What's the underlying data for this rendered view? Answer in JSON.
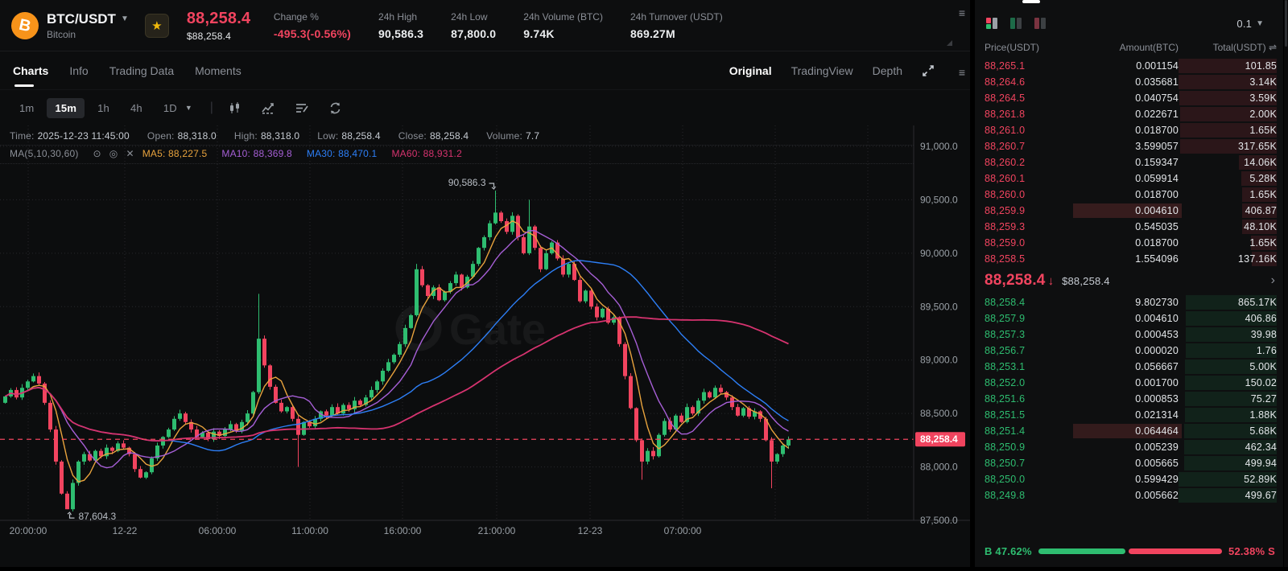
{
  "header": {
    "pair": "BTC/USDT",
    "coin_name": "Bitcoin",
    "logo_letter": "B",
    "last_price": "88,258.4",
    "last_price_usd": "$88,258.4",
    "stats": [
      {
        "label": "Change %",
        "value": "-495.3(-0.56%)",
        "red": true
      },
      {
        "label": "24h High",
        "value": "90,586.3",
        "red": false
      },
      {
        "label": "24h Low",
        "value": "87,800.0",
        "red": false
      },
      {
        "label": "24h Volume (BTC)",
        "value": "9.74K",
        "red": false
      },
      {
        "label": "24h Turnover (USDT)",
        "value": "869.27M",
        "red": false
      }
    ]
  },
  "tabs": {
    "left": [
      "Charts",
      "Info",
      "Trading Data",
      "Moments"
    ],
    "left_active": 0,
    "right": [
      "Original",
      "TradingView",
      "Depth"
    ],
    "right_active": 0
  },
  "toolbar": {
    "timeframes": [
      "1m",
      "15m",
      "1h",
      "4h",
      "1D"
    ],
    "active": "15m"
  },
  "info_bar": [
    {
      "label": "Time:",
      "value": "2025-12-23 11:45:00"
    },
    {
      "label": "Open:",
      "value": "88,318.0"
    },
    {
      "label": "High:",
      "value": "88,318.0"
    },
    {
      "label": "Low:",
      "value": "88,258.4"
    },
    {
      "label": "Close:",
      "value": "88,258.4"
    },
    {
      "label": "Volume:",
      "value": "7.7"
    }
  ],
  "ma_bar": {
    "label": "MA(5,10,30,60)",
    "items": [
      {
        "name": "MA5:",
        "value": "88,227.5",
        "color": "#e8a33d"
      },
      {
        "name": "MA10:",
        "value": "88,369.8",
        "color": "#a65fd6"
      },
      {
        "name": "MA30:",
        "value": "88,470.1",
        "color": "#2d7ff7"
      },
      {
        "name": "MA60:",
        "value": "88,931.2",
        "color": "#d6336f"
      }
    ]
  },
  "chart_data": {
    "type": "candlestick",
    "watermark": "Gate",
    "price_min": 87500,
    "price_max": 91000,
    "y_ticks": [
      {
        "value": 91000,
        "label": "91,000.0"
      },
      {
        "value": 90500,
        "label": "90,500.0"
      },
      {
        "value": 90000,
        "label": "90,000.0"
      },
      {
        "value": 89500,
        "label": "89,500.0"
      },
      {
        "value": 89000,
        "label": "89,000.0"
      },
      {
        "value": 88500,
        "label": "88,500.0"
      },
      {
        "value": 88000,
        "label": "88,000.0"
      },
      {
        "value": 87500,
        "label": "87,500.0"
      }
    ],
    "x_labels": [
      {
        "x": 35,
        "label": "20:00:00"
      },
      {
        "x": 155,
        "label": "12-22"
      },
      {
        "x": 270,
        "label": "06:00:00"
      },
      {
        "x": 385,
        "label": "11:00:00"
      },
      {
        "x": 500,
        "label": "16:00:00"
      },
      {
        "x": 617,
        "label": "21:00:00"
      },
      {
        "x": 733,
        "label": "12-23"
      },
      {
        "x": 848,
        "label": "07:00:00"
      }
    ],
    "extra_gridlines": [
      963,
      1078
    ],
    "open_first": 88600,
    "closes": [
      88660,
      88720,
      88650,
      88740,
      88800,
      88850,
      88780,
      88600,
      88350,
      88050,
      87750,
      87604,
      87850,
      88050,
      88120,
      88060,
      88150,
      88100,
      88180,
      88150,
      88220,
      88180,
      88120,
      87980,
      87900,
      87950,
      88080,
      88200,
      88280,
      88350,
      88450,
      88500,
      88420,
      88350,
      88280,
      88320,
      88260,
      88330,
      88290,
      88350,
      88400,
      88340,
      88420,
      88500,
      88700,
      89200,
      88950,
      88750,
      88600,
      88520,
      88560,
      88450,
      88300,
      88420,
      88380,
      88450,
      88520,
      88480,
      88560,
      88500,
      88580,
      88540,
      88620,
      88580,
      88650,
      88720,
      88800,
      88900,
      88980,
      89050,
      89150,
      89300,
      89420,
      89850,
      89700,
      89600,
      89680,
      89560,
      89640,
      89720,
      89800,
      89680,
      89780,
      89900,
      90050,
      90150,
      90280,
      90380,
      90300,
      90200,
      90350,
      90150,
      90000,
      90250,
      90050,
      89850,
      90000,
      90100,
      89950,
      89800,
      89900,
      89750,
      89550,
      89650,
      89500,
      89400,
      89480,
      89350,
      89400,
      89150,
      88850,
      88550,
      88250,
      88050,
      88150,
      88100,
      88300,
      88430,
      88350,
      88480,
      88420,
      88560,
      88500,
      88620,
      88700,
      88650,
      88740,
      88700,
      88650,
      88560,
      88480,
      88550,
      88470,
      88520,
      88450,
      88250,
      88050,
      88120,
      88200,
      88258
    ],
    "wick_overrides": {
      "11": {
        "low": 87604.3
      },
      "45": {
        "high": 89620
      },
      "52": {
        "low": 88000
      },
      "73": {
        "high": 89900
      },
      "87": {
        "high": 90586.3
      },
      "93": {
        "high": 90500
      },
      "113": {
        "low": 87880
      },
      "136": {
        "low": 87800
      }
    },
    "ma_lines": [
      {
        "period": 5,
        "color": "#e8a33d"
      },
      {
        "period": 10,
        "color": "#a65fd6"
      },
      {
        "period": 30,
        "color": "#2d7ff7"
      },
      {
        "period": 60,
        "color": "#d6336f"
      }
    ],
    "annotations": [
      {
        "candle": 87,
        "price": 90586.3,
        "text": "90,586.3",
        "side": "high"
      },
      {
        "candle": 11,
        "price": 87604.3,
        "text": "87,604.3",
        "side": "low"
      }
    ],
    "last_price_line": {
      "price": 88258.4,
      "label": "88,258.4",
      "color": "#f1445f"
    },
    "candle_up_color": "#2ebd70",
    "candle_down_color": "#f1445f"
  },
  "order_book": {
    "precision": "0.1",
    "columns": [
      "Price(USDT)",
      "Amount(BTC)",
      "Total(USDT)"
    ],
    "columns_icon": "⇌",
    "asks": [
      {
        "price": "88,265.1",
        "amount": "0.001154",
        "total": "101.85"
      },
      {
        "price": "88,264.6",
        "amount": "0.035681",
        "total": "3.14K"
      },
      {
        "price": "88,264.5",
        "amount": "0.040754",
        "total": "3.59K"
      },
      {
        "price": "88,261.8",
        "amount": "0.022671",
        "total": "2.00K"
      },
      {
        "price": "88,261.0",
        "amount": "0.018700",
        "total": "1.65K"
      },
      {
        "price": "88,260.7",
        "amount": "3.599057",
        "total": "317.65K"
      },
      {
        "price": "88,260.2",
        "amount": "0.159347",
        "total": "14.06K"
      },
      {
        "price": "88,260.1",
        "amount": "0.059914",
        "total": "5.28K"
      },
      {
        "price": "88,260.0",
        "amount": "0.018700",
        "total": "1.65K"
      },
      {
        "price": "88,259.9",
        "amount": "0.004610",
        "total": "406.87",
        "flash": true
      },
      {
        "price": "88,259.3",
        "amount": "0.545035",
        "total": "48.10K"
      },
      {
        "price": "88,259.0",
        "amount": "0.018700",
        "total": "1.65K"
      },
      {
        "price": "88,258.5",
        "amount": "1.554096",
        "total": "137.16K"
      }
    ],
    "mid": {
      "price": "88,258.4",
      "arrow": "↓",
      "usd": "$88,258.4",
      "chevron": "›"
    },
    "bids": [
      {
        "price": "88,258.4",
        "amount": "9.802730",
        "total": "865.17K"
      },
      {
        "price": "88,257.9",
        "amount": "0.004610",
        "total": "406.86"
      },
      {
        "price": "88,257.3",
        "amount": "0.000453",
        "total": "39.98"
      },
      {
        "price": "88,256.7",
        "amount": "0.000020",
        "total": "1.76"
      },
      {
        "price": "88,253.1",
        "amount": "0.056667",
        "total": "5.00K"
      },
      {
        "price": "88,252.0",
        "amount": "0.001700",
        "total": "150.02"
      },
      {
        "price": "88,251.6",
        "amount": "0.000853",
        "total": "75.27"
      },
      {
        "price": "88,251.5",
        "amount": "0.021314",
        "total": "1.88K"
      },
      {
        "price": "88,251.4",
        "amount": "0.064464",
        "total": "5.68K",
        "flash": true
      },
      {
        "price": "88,250.9",
        "amount": "0.005239",
        "total": "462.34"
      },
      {
        "price": "88,250.7",
        "amount": "0.005665",
        "total": "499.94"
      },
      {
        "price": "88,250.0",
        "amount": "0.599429",
        "total": "52.89K"
      },
      {
        "price": "88,249.8",
        "amount": "0.005662",
        "total": "499.67"
      }
    ],
    "ratio": {
      "buy_label": "B",
      "buy_pct": "47.62%",
      "sell_pct": "52.38%",
      "sell_label": "S",
      "buy_width": 47.62
    }
  }
}
